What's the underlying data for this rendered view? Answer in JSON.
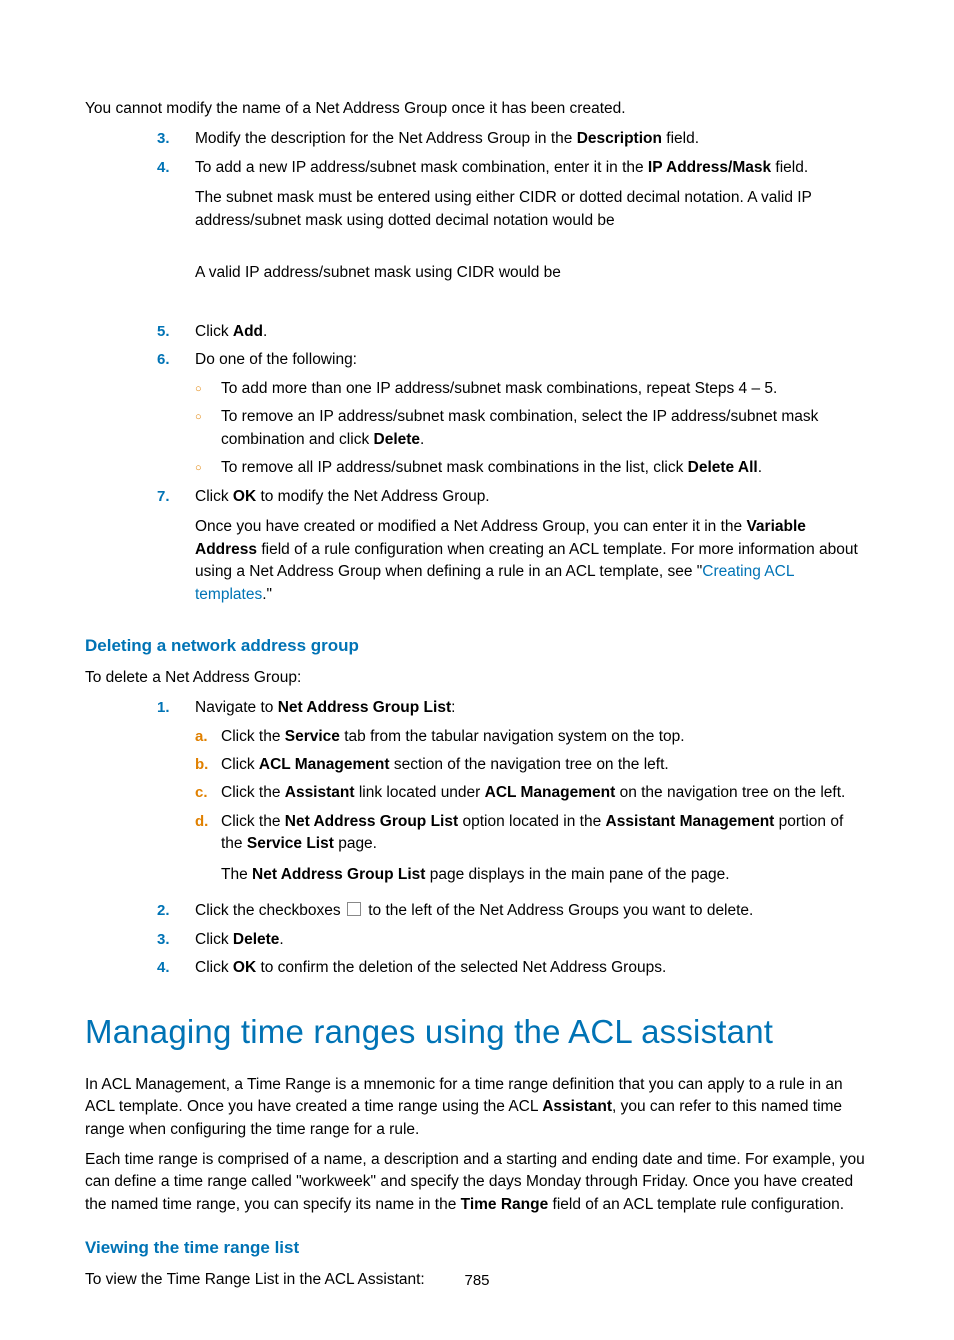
{
  "pageNumber": "785",
  "topPara": "You cannot modify the name of a Net Address Group once it has been created.",
  "topList": {
    "i3": {
      "marker": "3.",
      "pre": "Modify the description for the Net Address Group in the ",
      "bold": "Description",
      "post": " field."
    },
    "i4": {
      "marker": "4.",
      "pre": "To add a new IP address/subnet mask combination, enter it in the ",
      "bold": "IP Address/Mask",
      "post": " field.",
      "note1": "The subnet mask must be entered using either CIDR or dotted decimal notation. A valid IP address/subnet mask using dotted decimal notation would be",
      "note2": "A valid IP address/subnet mask using CIDR would be"
    },
    "i5": {
      "marker": "5.",
      "pre": "Click ",
      "bold": "Add",
      "post": "."
    },
    "i6": {
      "marker": "6.",
      "text": "Do one of the following:",
      "sub": {
        "a": "To add more than one IP address/subnet mask combinations, repeat Steps 4 – 5.",
        "b": {
          "pre": "To remove an IP address/subnet mask combination, select the IP address/subnet mask combination and click ",
          "bold": "Delete",
          "post": "."
        },
        "c": {
          "pre": "To remove all IP address/subnet mask combinations in the list, click ",
          "bold": "Delete All",
          "post": "."
        }
      }
    },
    "i7": {
      "marker": "7.",
      "pre": "Click ",
      "bold": "OK",
      "post": " to modify the Net Address Group.",
      "para": {
        "t1": "Once you have created or modified a Net Address Group, you can enter it in the ",
        "b1": "Variable Address",
        "t2": " field of a rule configuration when creating an ACL template. For more information about using a Net Address Group when defining a rule in an ACL template, see \"",
        "link": "Creating ACL templates",
        "t3": ".\""
      }
    }
  },
  "section1": {
    "heading": "Deleting a network address group",
    "intro": "To delete a Net Address Group:",
    "list": {
      "i1": {
        "marker": "1.",
        "pre": "Navigate to ",
        "bold": "Net Address Group List",
        "post": ":",
        "sub": {
          "a": {
            "marker": "a.",
            "t1": "Click the ",
            "b1": "Service",
            "t2": " tab from the tabular navigation system on the top."
          },
          "b": {
            "marker": "b.",
            "t1": "Click ",
            "b1": "ACL Management",
            "t2": " section of the navigation tree on the left."
          },
          "c": {
            "marker": "c.",
            "t1": "Click the ",
            "b1": "Assistant",
            "t2": " link located under ",
            "b2": "ACL Management",
            "t3": " on the navigation tree on the left."
          },
          "d": {
            "marker": "d.",
            "t1": "Click the ",
            "b1": "Net Address Group List",
            "t2": " option located in the ",
            "b2": "Assistant Management",
            "t3": " portion of the ",
            "b3": "Service List",
            "t4": " page."
          },
          "note": {
            "t1": "The ",
            "b1": "Net Address Group List",
            "t2": " page displays in the main pane of the page."
          }
        }
      },
      "i2": {
        "marker": "2.",
        "pre": "Click the checkboxes ",
        "post": " to the left of the Net Address Groups you want to delete."
      },
      "i3": {
        "marker": "3.",
        "pre": "Click ",
        "bold": "Delete",
        "post": "."
      },
      "i4": {
        "marker": "4.",
        "pre": "Click ",
        "bold": "OK",
        "post": " to confirm the deletion of the selected Net Address Groups."
      }
    }
  },
  "section2": {
    "heading": "Managing time ranges using the ACL assistant",
    "p1": {
      "t1": "In ACL Management, a Time Range is a mnemonic for a time range definition that you can apply to a rule in an ACL template. Once you have created a time range using the ACL ",
      "b1": "Assistant",
      "t2": ", you can refer to this named time range when configuring the time range for a rule."
    },
    "p2": {
      "t1": "Each time range is comprised of a name, a description and a starting and ending date and time. For example, you can define a time range called \"workweek\" and specify the days Monday through Friday. Once you have created the named time range, you can specify its name in the ",
      "b1": "Time Range",
      "t2": " field of an ACL template rule configuration."
    }
  },
  "section3": {
    "heading": "Viewing the time range list",
    "intro": "To view the Time Range List in the ACL Assistant:"
  }
}
